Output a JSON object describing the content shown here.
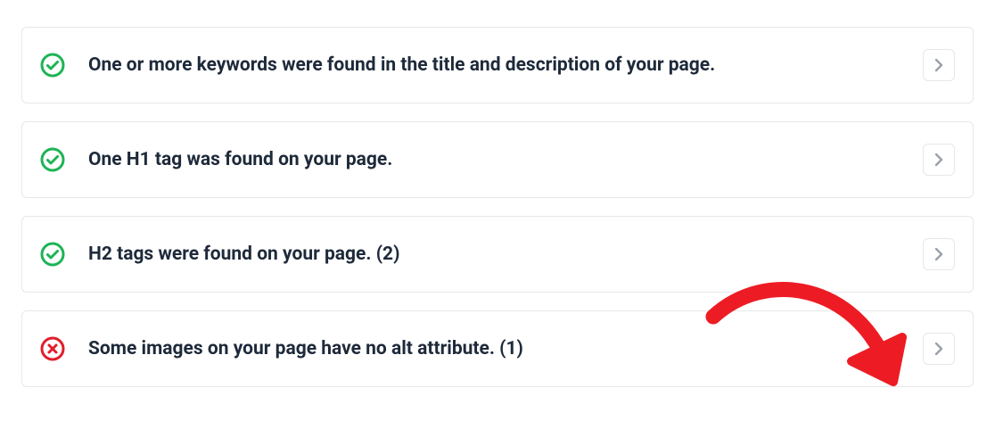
{
  "checks": [
    {
      "status": "pass",
      "text": "One or more keywords were found in the title and description of your page."
    },
    {
      "status": "pass",
      "text": "One H1 tag was found on your page."
    },
    {
      "status": "pass",
      "text": "H2 tags were found on your page. (2)"
    },
    {
      "status": "fail",
      "text": "Some images on your page have no alt attribute. (1)"
    }
  ],
  "colors": {
    "pass": "#1db455",
    "fail": "#e11d2b",
    "chevron": "#9aa1ab",
    "annotation": "#ed1c24"
  }
}
